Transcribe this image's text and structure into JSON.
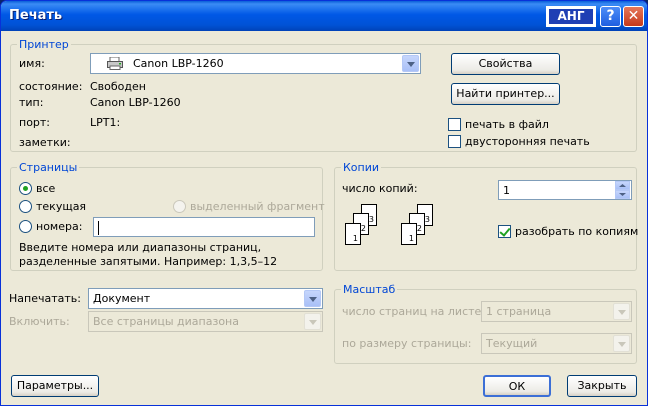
{
  "window": {
    "title": "Печать",
    "lang_indicator": "АНГ",
    "help_glyph": "?",
    "close_glyph": "✕"
  },
  "printer": {
    "group_label": "Принтер",
    "name_label": "имя:",
    "name_value": "Canon LBP-1260",
    "status_label": "состояние:",
    "status_value": "Свободен",
    "type_label": "тип:",
    "type_value": "Canon LBP-1260",
    "port_label": "порт:",
    "port_value": "LPT1:",
    "notes_label": "заметки:",
    "properties_button": "Свойства",
    "find_printer_button": "Найти принтер...",
    "print_to_file_label": "печать в файл",
    "print_to_file_checked": false,
    "duplex_label": "двусторонняя печать",
    "duplex_checked": false
  },
  "pages": {
    "group_label": "Страницы",
    "all_label": "все",
    "current_label": "текущая",
    "selection_label": "выделенный фрагмент",
    "numbers_label": "номера:",
    "numbers_value": "",
    "selected": "all",
    "hint": "Введите номера или диапазоны страниц, разделенные запятыми. Например: 1,3,5–12"
  },
  "copies": {
    "group_label": "Копии",
    "count_label": "число копий:",
    "count_value": "1",
    "collate_label": "разобрать по копиям",
    "collate_checked": true,
    "page_numbers": [
      "1",
      "2",
      "3"
    ]
  },
  "print_what": {
    "label": "Напечатать:",
    "value": "Документ",
    "include_label": "Включить:",
    "include_value": "Все страницы диапазона"
  },
  "zoom": {
    "group_label": "Масштаб",
    "pages_per_sheet_label": "число страниц на листе:",
    "pages_per_sheet_value": "1 страница",
    "scale_to_paper_label": "по размеру страницы:",
    "scale_to_paper_value": "Текущий"
  },
  "footer": {
    "options_button": "Параметры...",
    "ok_button": "ОК",
    "close_button": "Закрыть"
  }
}
